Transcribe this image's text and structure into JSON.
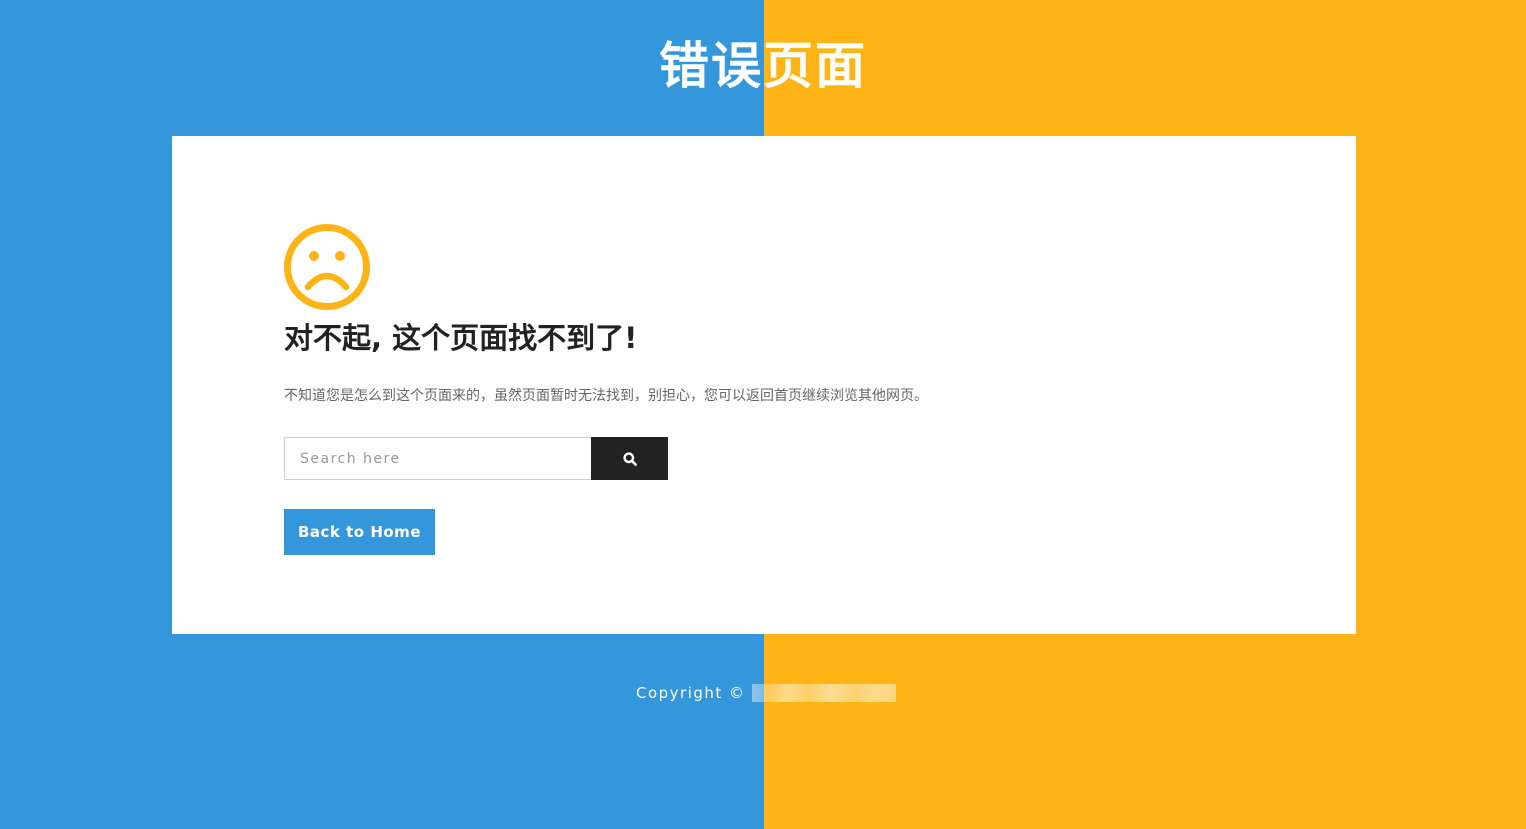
{
  "colors": {
    "left_bg": "#3597db",
    "right_bg": "#feb415",
    "card_bg": "#ffffff",
    "icon": "#feb415",
    "heading": "#222222",
    "text": "#666666",
    "search_button_bg": "#222222",
    "home_button_bg": "#3597db"
  },
  "header": {
    "title": "错误页面"
  },
  "main": {
    "icon": "sad-face-icon",
    "heading": "对不起, 这个页面找不到了!",
    "description": "不知道您是怎么到这个页面来的，虽然页面暂时无法找到，别担心，您可以返回首页继续浏览其他网页。",
    "search": {
      "placeholder": "Search here",
      "value": "",
      "button_icon": "search-icon"
    },
    "home_button": "Back to Home"
  },
  "footer": {
    "copyright": "Copyright ©"
  }
}
